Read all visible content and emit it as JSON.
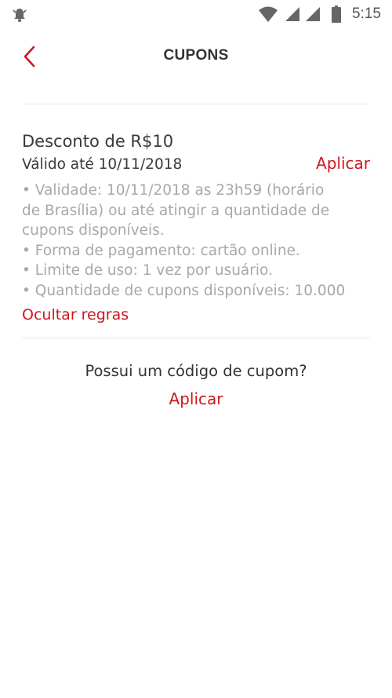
{
  "status_bar": {
    "left_icon": "notification-bell-icon",
    "icons": [
      "wifi-icon",
      "signal-icon",
      "signal-icon",
      "battery-icon"
    ],
    "time": "5:15"
  },
  "header": {
    "back_icon": "chevron-left-icon",
    "title": "CUPONS"
  },
  "coupon": {
    "title": "Desconto de R$10",
    "valid_until": "Válido até 10/11/2018",
    "apply_label": "Aplicar",
    "rules": [
      "• Validade: 10/11/2018 as 23h59 (horário",
      "de Brasília) ou até atingir a quantidade de",
      "cupons disponíveis.",
      "• Forma de pagamento: cartão online.",
      "• Limite de uso: 1 vez por usuário.",
      "• Quantidade de cupons disponíveis: 10.000"
    ],
    "hide_rules_label": "Ocultar regras"
  },
  "code_section": {
    "question": "Possui um código de cupom?",
    "apply_label": "Aplicar"
  },
  "colors": {
    "accent": "#d0161f",
    "text_primary": "#3a3a3a",
    "text_secondary": "#a8a8a8"
  }
}
